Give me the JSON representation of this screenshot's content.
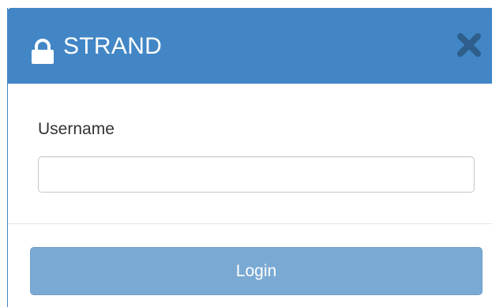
{
  "dialog": {
    "title": "STRAND",
    "icons": {
      "title_icon": "lock-icon",
      "close": "close-icon"
    },
    "colors": {
      "header": "#4286c6",
      "button": "#7aaad4"
    }
  },
  "form": {
    "username_label": "Username",
    "username_value": "",
    "username_placeholder": ""
  },
  "actions": {
    "login_label": "Login"
  }
}
